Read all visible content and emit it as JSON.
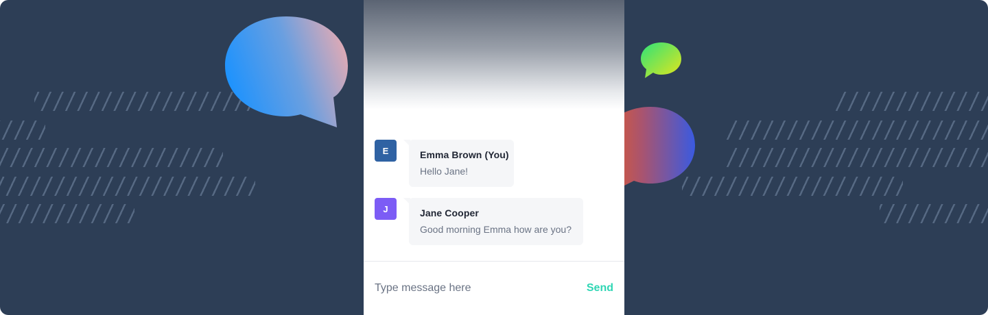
{
  "colors": {
    "background": "#2d3e56",
    "accent_send": "#2fd6b4",
    "avatar_emma": "#2f62a3",
    "avatar_jane": "#7c5cf5"
  },
  "decorations": [
    "blue-chat-bubble-icon",
    "green-chat-bubble-icon",
    "orange-chat-bubble-icon",
    "diagonal-hatch-pattern"
  ],
  "messages": [
    {
      "initial": "E",
      "sender": "Emma Brown (You)",
      "text": "Hello Jane!"
    },
    {
      "initial": "J",
      "sender": "Jane Cooper",
      "text": "Good morning Emma how are you?"
    }
  ],
  "composer": {
    "placeholder": "Type message here",
    "send_label": "Send"
  }
}
